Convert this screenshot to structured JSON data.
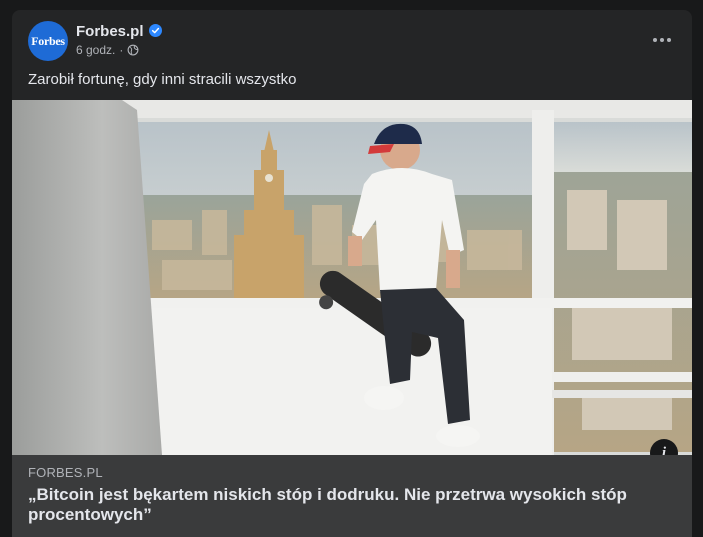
{
  "post": {
    "page_name": "Forbes.pl",
    "avatar_text": "Forbes",
    "timestamp": "6 godz.",
    "separator": "·",
    "text": "Zarobił fortunę, gdy inni stracili wszystko"
  },
  "link_preview": {
    "domain": "FORBES.PL",
    "headline": "„Bitcoin jest bękartem niskich stóp i dodruku. Nie przetrwa wysokich stóp procentowych”",
    "info_glyph": "i"
  },
  "icons": {
    "verified": "verified-badge-icon",
    "privacy": "globe-icon",
    "more": "more-options-icon",
    "info": "info-icon"
  },
  "colors": {
    "background": "#18191a",
    "card": "#242526",
    "link_box": "#3a3b3c",
    "verified": "#2d88ff",
    "avatar": "#1e6bd6"
  }
}
